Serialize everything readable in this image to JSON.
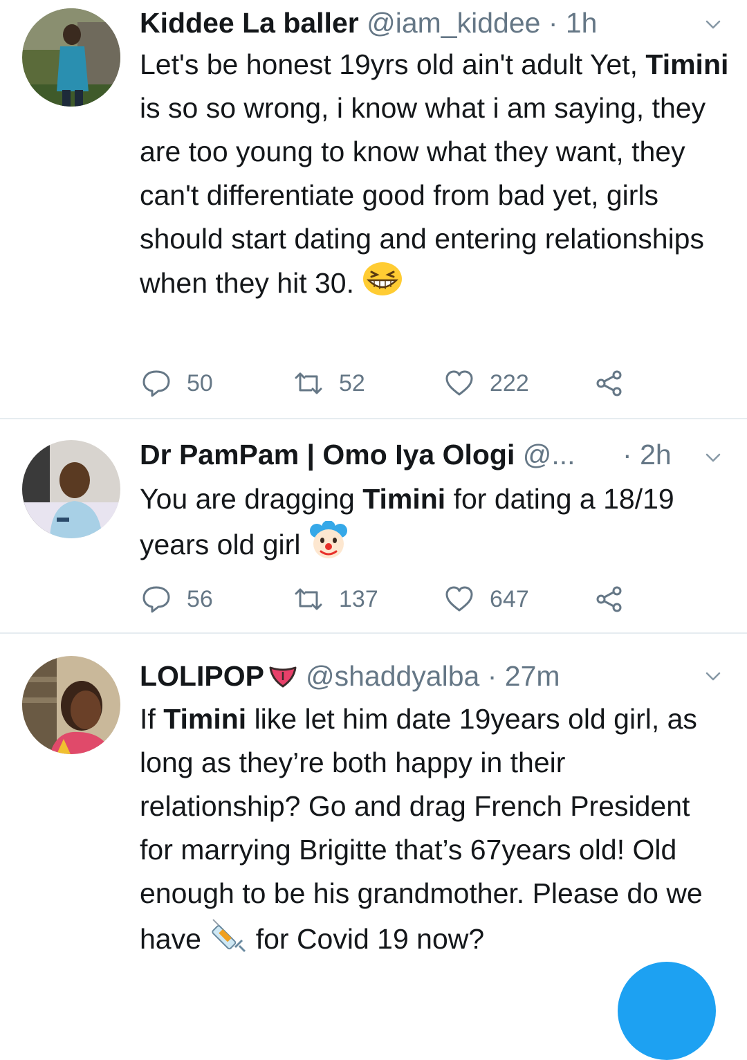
{
  "tweets": [
    {
      "name": "Kiddee La baller",
      "handle": "@iam_kiddee",
      "time": "1h",
      "body": {
        "p1": "Let's be honest 19yrs old ain't adult Yet, ",
        "b1": "Timini",
        "p2": " is so so wrong, i know what i am saying, they are too young to know what they want, they can't differentiate good from bad yet, girls should start dating and entering relationships when they hit 30. "
      },
      "emoji": "grinning-squinting-face",
      "replies": "50",
      "retweets": "52",
      "likes": "222"
    },
    {
      "name": "Dr PamPam | Omo Iya Ologi",
      "handle": "@...",
      "time": "2h",
      "body": {
        "p1": "You are dragging ",
        "b1": "Timini",
        "p2": " for dating a 18/19 years old girl "
      },
      "emoji": "clown-face",
      "replies": "56",
      "retweets": "137",
      "likes": "647"
    },
    {
      "name": "LOLIPOP",
      "handle": "@shaddyalba",
      "time": "27m",
      "body": {
        "p0": "If ",
        "b1": "Timini",
        "p2": " like let him date 19years old girl, as long as they’re both happy in their relationship? Go and drag French President for marrying Brigitte that’s 67years old! Old enough to be his grandmother. Please do we have ",
        "p3": " for Covid 19 now?"
      },
      "name_emoji": "tongue",
      "emoji": "syringe"
    }
  ],
  "sep": " · ",
  "colors": {
    "text": "#14171a",
    "secondary": "#657786",
    "divider": "#e6ecf0",
    "accent": "#1da1f2"
  }
}
